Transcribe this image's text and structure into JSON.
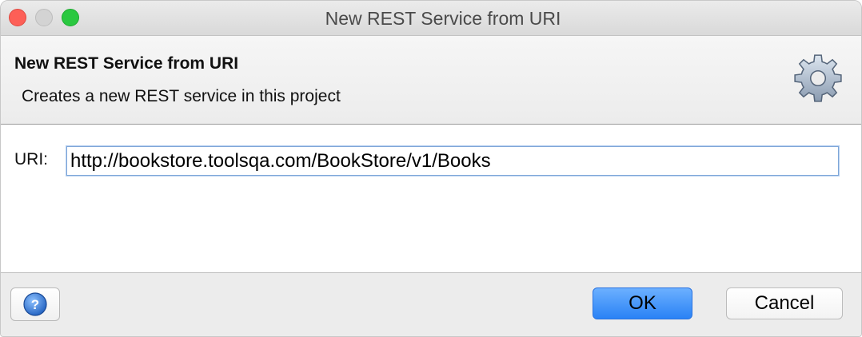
{
  "window": {
    "title": "New REST Service from URI",
    "controls": [
      "close-icon",
      "minimize-icon",
      "maximize-icon"
    ]
  },
  "header": {
    "title": "New REST Service from URI",
    "subtitle": "Creates a new REST service in this project",
    "icon": "gear-icon"
  },
  "form": {
    "uri_label": "URI:",
    "uri_value": "http://bookstore.toolsqa.com/BookStore/v1/Books"
  },
  "footer": {
    "help_icon": "help-icon",
    "ok_label": "OK",
    "cancel_label": "Cancel"
  },
  "colors": {
    "close": "#fd5f57",
    "accent": "#2a82f5",
    "input_focus": "#7ea6d8"
  }
}
